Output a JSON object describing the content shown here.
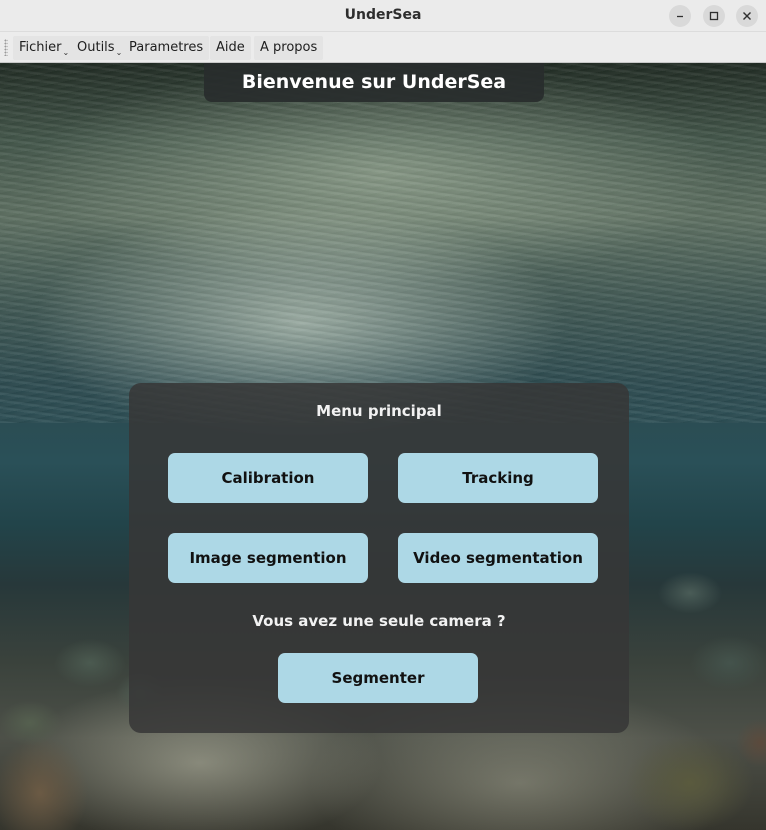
{
  "window": {
    "title": "UnderSea",
    "controls": {
      "minimize": "–",
      "maximize": "□",
      "close": "✕"
    }
  },
  "menubar": {
    "items": [
      {
        "label": "Fichier",
        "has_submenu": true
      },
      {
        "label": "Outils",
        "has_submenu": true
      },
      {
        "label": "Parametres",
        "has_submenu": false
      },
      {
        "label": "Aide",
        "has_submenu": false
      },
      {
        "label": "A propos",
        "has_submenu": false
      }
    ],
    "submenu_indicator": "⌄"
  },
  "header": {
    "title": "Bienvenue sur UnderSea"
  },
  "main_menu": {
    "title": "Menu principal",
    "buttons": {
      "calibration": "Calibration",
      "tracking": "Tracking",
      "image_segmentation": "Image segmention",
      "video_segmentation": "Video segmentation"
    },
    "camera_question": "Vous avez une seule camera ?",
    "segment_button": "Segmenter"
  },
  "colors": {
    "button_background": "#add8e6",
    "panel_background": "#373737",
    "banner_background": "#282c2c"
  }
}
